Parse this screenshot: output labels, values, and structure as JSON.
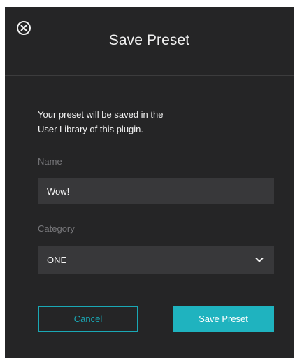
{
  "dialog": {
    "title": "Save Preset",
    "close_icon": "close-circle-icon",
    "description_line1": "Your preset will be saved in the",
    "description_line2": "User Library of this plugin."
  },
  "form": {
    "name_label": "Name",
    "name_value": "Wow!",
    "category_label": "Category",
    "category_value": "ONE",
    "category_icon": "chevron-down-icon"
  },
  "buttons": {
    "cancel_label": "Cancel",
    "save_label": "Save Preset"
  },
  "colors": {
    "background": "#252526",
    "field_background": "#38383a",
    "accent": "#1fb3bf",
    "label_muted": "#77777a",
    "text": "#f2f2f2"
  }
}
